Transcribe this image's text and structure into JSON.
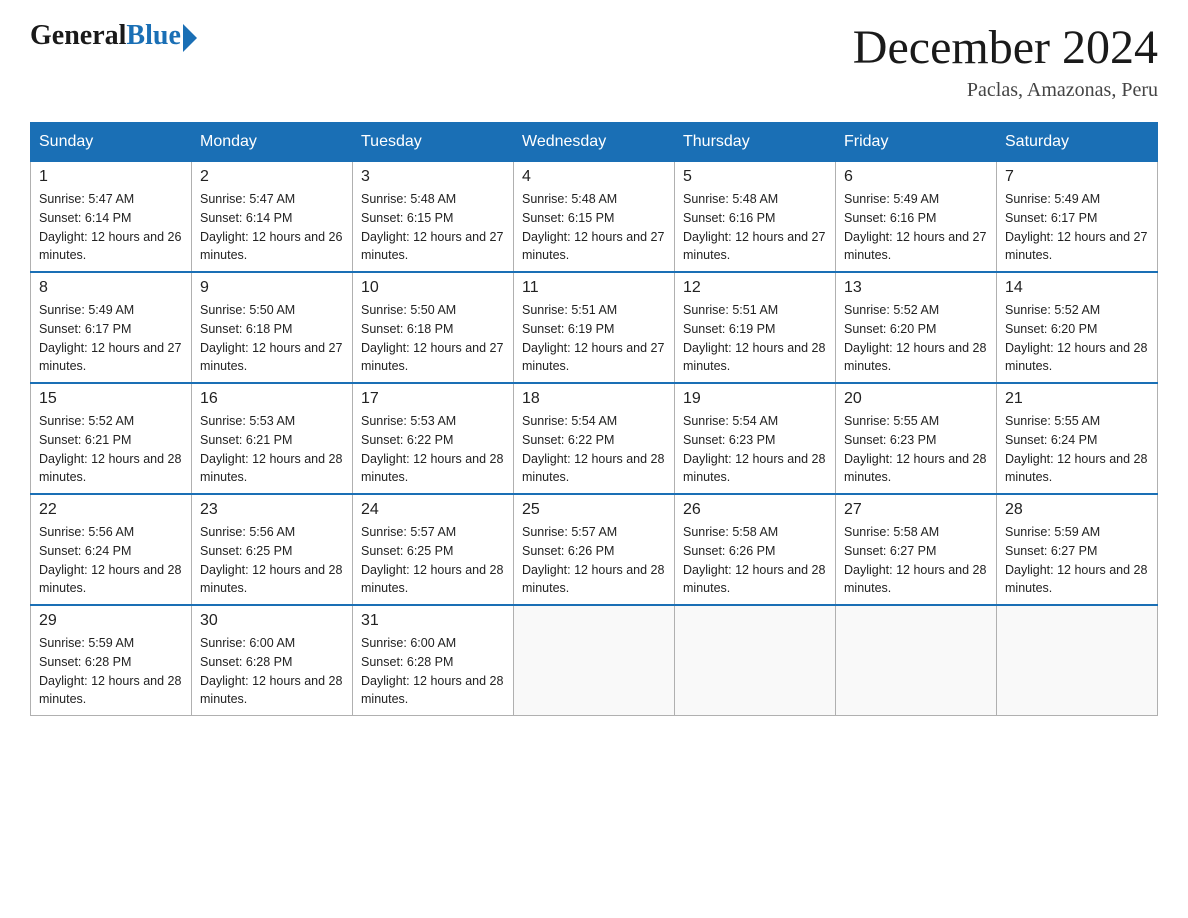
{
  "header": {
    "logo_general": "General",
    "logo_blue": "Blue",
    "month_year": "December 2024",
    "location": "Paclas, Amazonas, Peru"
  },
  "weekdays": [
    "Sunday",
    "Monday",
    "Tuesday",
    "Wednesday",
    "Thursday",
    "Friday",
    "Saturday"
  ],
  "weeks": [
    [
      {
        "day": "1",
        "sunrise": "5:47 AM",
        "sunset": "6:14 PM",
        "daylight": "12 hours and 26 minutes."
      },
      {
        "day": "2",
        "sunrise": "5:47 AM",
        "sunset": "6:14 PM",
        "daylight": "12 hours and 26 minutes."
      },
      {
        "day": "3",
        "sunrise": "5:48 AM",
        "sunset": "6:15 PM",
        "daylight": "12 hours and 27 minutes."
      },
      {
        "day": "4",
        "sunrise": "5:48 AM",
        "sunset": "6:15 PM",
        "daylight": "12 hours and 27 minutes."
      },
      {
        "day": "5",
        "sunrise": "5:48 AM",
        "sunset": "6:16 PM",
        "daylight": "12 hours and 27 minutes."
      },
      {
        "day": "6",
        "sunrise": "5:49 AM",
        "sunset": "6:16 PM",
        "daylight": "12 hours and 27 minutes."
      },
      {
        "day": "7",
        "sunrise": "5:49 AM",
        "sunset": "6:17 PM",
        "daylight": "12 hours and 27 minutes."
      }
    ],
    [
      {
        "day": "8",
        "sunrise": "5:49 AM",
        "sunset": "6:17 PM",
        "daylight": "12 hours and 27 minutes."
      },
      {
        "day": "9",
        "sunrise": "5:50 AM",
        "sunset": "6:18 PM",
        "daylight": "12 hours and 27 minutes."
      },
      {
        "day": "10",
        "sunrise": "5:50 AM",
        "sunset": "6:18 PM",
        "daylight": "12 hours and 27 minutes."
      },
      {
        "day": "11",
        "sunrise": "5:51 AM",
        "sunset": "6:19 PM",
        "daylight": "12 hours and 27 minutes."
      },
      {
        "day": "12",
        "sunrise": "5:51 AM",
        "sunset": "6:19 PM",
        "daylight": "12 hours and 28 minutes."
      },
      {
        "day": "13",
        "sunrise": "5:52 AM",
        "sunset": "6:20 PM",
        "daylight": "12 hours and 28 minutes."
      },
      {
        "day": "14",
        "sunrise": "5:52 AM",
        "sunset": "6:20 PM",
        "daylight": "12 hours and 28 minutes."
      }
    ],
    [
      {
        "day": "15",
        "sunrise": "5:52 AM",
        "sunset": "6:21 PM",
        "daylight": "12 hours and 28 minutes."
      },
      {
        "day": "16",
        "sunrise": "5:53 AM",
        "sunset": "6:21 PM",
        "daylight": "12 hours and 28 minutes."
      },
      {
        "day": "17",
        "sunrise": "5:53 AM",
        "sunset": "6:22 PM",
        "daylight": "12 hours and 28 minutes."
      },
      {
        "day": "18",
        "sunrise": "5:54 AM",
        "sunset": "6:22 PM",
        "daylight": "12 hours and 28 minutes."
      },
      {
        "day": "19",
        "sunrise": "5:54 AM",
        "sunset": "6:23 PM",
        "daylight": "12 hours and 28 minutes."
      },
      {
        "day": "20",
        "sunrise": "5:55 AM",
        "sunset": "6:23 PM",
        "daylight": "12 hours and 28 minutes."
      },
      {
        "day": "21",
        "sunrise": "5:55 AM",
        "sunset": "6:24 PM",
        "daylight": "12 hours and 28 minutes."
      }
    ],
    [
      {
        "day": "22",
        "sunrise": "5:56 AM",
        "sunset": "6:24 PM",
        "daylight": "12 hours and 28 minutes."
      },
      {
        "day": "23",
        "sunrise": "5:56 AM",
        "sunset": "6:25 PM",
        "daylight": "12 hours and 28 minutes."
      },
      {
        "day": "24",
        "sunrise": "5:57 AM",
        "sunset": "6:25 PM",
        "daylight": "12 hours and 28 minutes."
      },
      {
        "day": "25",
        "sunrise": "5:57 AM",
        "sunset": "6:26 PM",
        "daylight": "12 hours and 28 minutes."
      },
      {
        "day": "26",
        "sunrise": "5:58 AM",
        "sunset": "6:26 PM",
        "daylight": "12 hours and 28 minutes."
      },
      {
        "day": "27",
        "sunrise": "5:58 AM",
        "sunset": "6:27 PM",
        "daylight": "12 hours and 28 minutes."
      },
      {
        "day": "28",
        "sunrise": "5:59 AM",
        "sunset": "6:27 PM",
        "daylight": "12 hours and 28 minutes."
      }
    ],
    [
      {
        "day": "29",
        "sunrise": "5:59 AM",
        "sunset": "6:28 PM",
        "daylight": "12 hours and 28 minutes."
      },
      {
        "day": "30",
        "sunrise": "6:00 AM",
        "sunset": "6:28 PM",
        "daylight": "12 hours and 28 minutes."
      },
      {
        "day": "31",
        "sunrise": "6:00 AM",
        "sunset": "6:28 PM",
        "daylight": "12 hours and 28 minutes."
      },
      null,
      null,
      null,
      null
    ]
  ],
  "labels": {
    "sunrise": "Sunrise:",
    "sunset": "Sunset:",
    "daylight": "Daylight:"
  }
}
